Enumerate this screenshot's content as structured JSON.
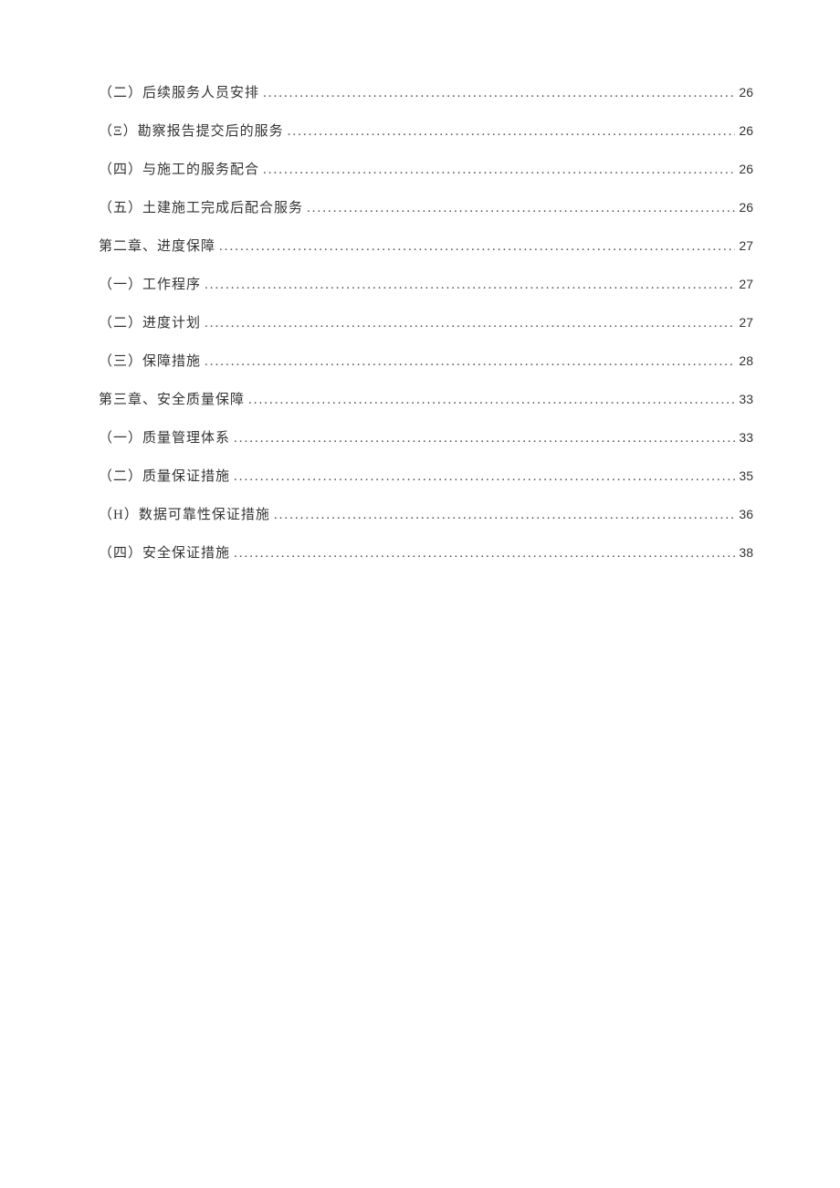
{
  "toc": [
    {
      "title": "（二）后续服务人员安排",
      "page": "26"
    },
    {
      "title": "（Ξ）勘察报告提交后的服务",
      "page": "26"
    },
    {
      "title": "（四）与施工的服务配合",
      "page": "26"
    },
    {
      "title": "（五）土建施工完成后配合服务",
      "page": "26"
    },
    {
      "title": "第二章、进度保障",
      "page": "27"
    },
    {
      "title": "（一）工作程序",
      "page": "27"
    },
    {
      "title": "（二）进度计划",
      "page": "27"
    },
    {
      "title": "（三）保障措施",
      "page": "28"
    },
    {
      "title": "第三章、安全质量保障",
      "page": "33"
    },
    {
      "title": "（一）质量管理体系",
      "page": "33"
    },
    {
      "title": "（二）质量保证措施",
      "page": "35"
    },
    {
      "title": "（H）数据可靠性保证措施",
      "page": "36"
    },
    {
      "title": "（四）安全保证措施",
      "page": "38"
    }
  ]
}
